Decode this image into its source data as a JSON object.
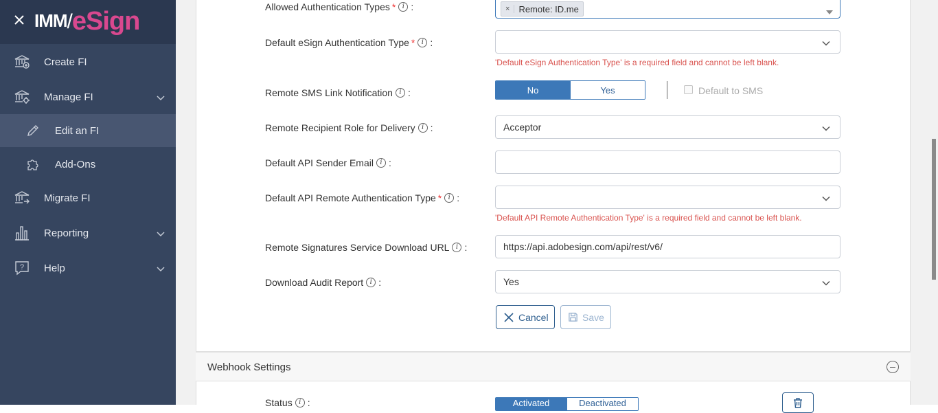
{
  "brand": {
    "part1": "IMM",
    "slash": "/",
    "part2": "eSign"
  },
  "sidebar": {
    "items": [
      {
        "label": "Create FI",
        "icon": "bank-add-icon"
      },
      {
        "label": "Manage FI",
        "icon": "bank-settings-icon",
        "expandable": true
      },
      {
        "label": "Edit an FI",
        "icon": "pencil-icon",
        "sub": true,
        "active": true
      },
      {
        "label": "Add-Ons",
        "icon": "puzzle-icon",
        "sub": true
      },
      {
        "label": "Migrate FI",
        "icon": "bank-migrate-icon"
      },
      {
        "label": "Reporting",
        "icon": "bar-chart-icon",
        "expandable": true
      },
      {
        "label": "Help",
        "icon": "help-icon",
        "expandable": true
      }
    ]
  },
  "form": {
    "allowed_auth": {
      "label": "Allowed Authentication Types",
      "tag_remove": "×",
      "tag": "Remote: ID.me"
    },
    "default_esign_auth": {
      "label": "Default eSign Authentication Type",
      "value": "",
      "error": "'Default eSign Authentication Type' is a required field and cannot be left blank."
    },
    "remote_sms": {
      "label": "Remote SMS Link Notification",
      "no": "No",
      "yes": "Yes",
      "default_sms": "Default to SMS"
    },
    "recipient_role": {
      "label": "Remote Recipient Role for Delivery",
      "value": "Acceptor"
    },
    "api_sender_email": {
      "label": "Default API Sender Email",
      "value": ""
    },
    "api_remote_auth": {
      "label": "Default API Remote Authentication Type",
      "value": "",
      "error": "'Default API Remote Authentication Type' is a required field and cannot be left blank."
    },
    "download_url": {
      "label": "Remote Signatures Service Download URL",
      "value": "https://api.adobesign.com/api/rest/v6/"
    },
    "audit_report": {
      "label": "Download Audit Report",
      "value": "Yes"
    },
    "required_mark": "*",
    "info_glyph": "i",
    "colon": ":",
    "cancel_label": "Cancel",
    "save_label": "Save"
  },
  "webhook": {
    "title": "Webhook Settings",
    "status_label": "Status",
    "activated": "Activated",
    "deactivated": "Deactivated"
  },
  "colors": {
    "primary": "#3c78b8",
    "sidebar": "#36455f",
    "error": "#d9534f",
    "brand_accent": "#d9488f"
  }
}
